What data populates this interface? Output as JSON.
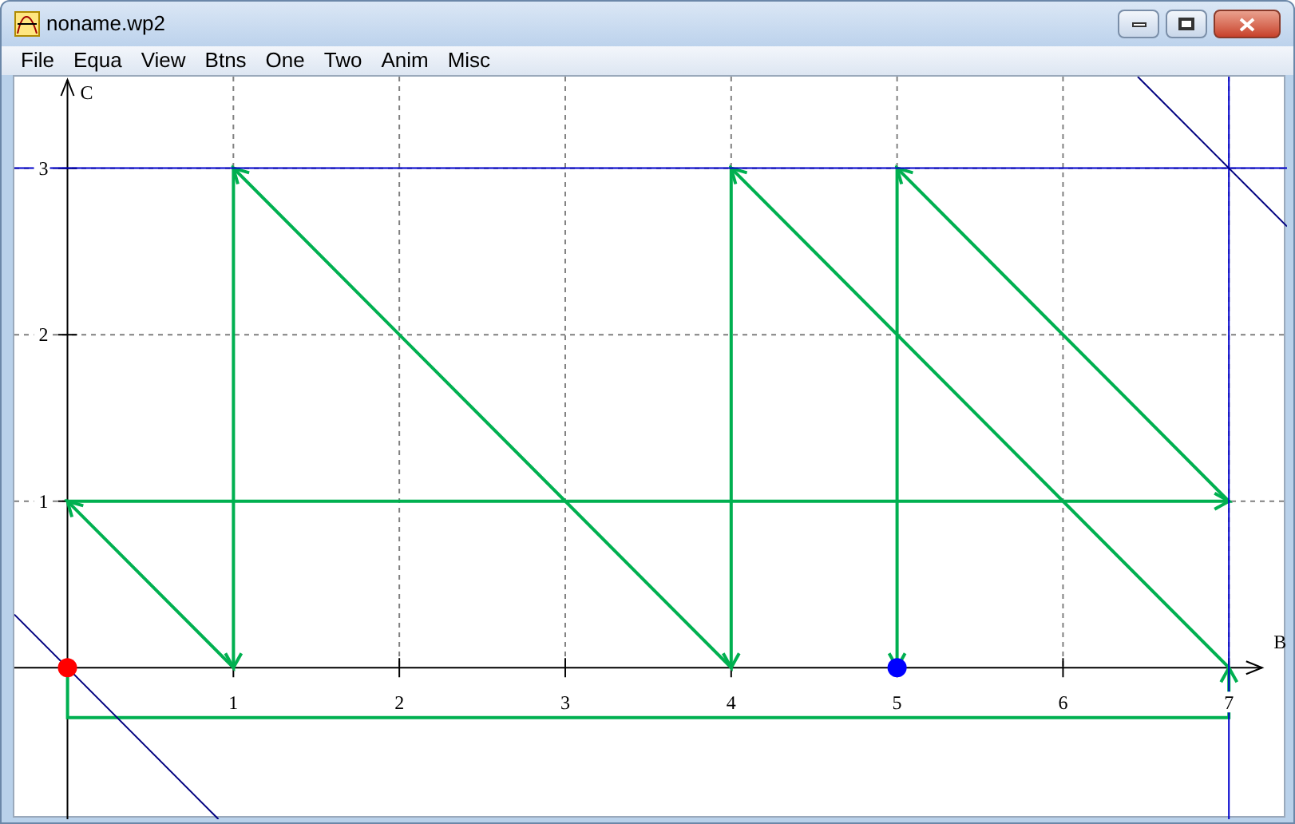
{
  "window": {
    "title": "noname.wp2"
  },
  "menu": [
    "File",
    "Equa",
    "View",
    "Btns",
    "One",
    "Two",
    "Anim",
    "Misc"
  ],
  "plot": {
    "chart_data": {
      "type": "line",
      "xlabel": "B",
      "ylabel": "C",
      "xlim": [
        -0.32,
        7.35
      ],
      "ylim": [
        -0.91,
        3.55
      ],
      "xticks": [
        1,
        2,
        3,
        4,
        5,
        6,
        7
      ],
      "yticks": [
        1,
        2,
        3
      ],
      "grid": true,
      "series": [
        {
          "color": "#00b050",
          "x": [
            0,
            0,
            7,
            7,
            4,
            4,
            1,
            1,
            0,
            7,
            5,
            5
          ],
          "values": [
            0,
            -0.3,
            -0.3,
            0,
            3,
            0,
            3,
            0,
            1,
            1,
            3,
            0
          ]
        },
        {
          "color": "#0000cc",
          "x": [
            -0.32,
            7.35
          ],
          "values": [
            3,
            3
          ]
        },
        {
          "color": "#0000cc",
          "x": [
            7,
            7
          ],
          "values": [
            -0.91,
            3.55
          ]
        },
        {
          "color": "#000080",
          "x": [
            6.45,
            7.35
          ],
          "values": [
            3.55,
            2.65
          ]
        },
        {
          "color": "#000080",
          "x": [
            -0.32,
            0.91
          ],
          "values": [
            0.32,
            -0.91
          ]
        }
      ]
    },
    "markers": [
      {
        "color": "#ff0000"
      },
      {
        "color": "#0000ff"
      }
    ]
  }
}
